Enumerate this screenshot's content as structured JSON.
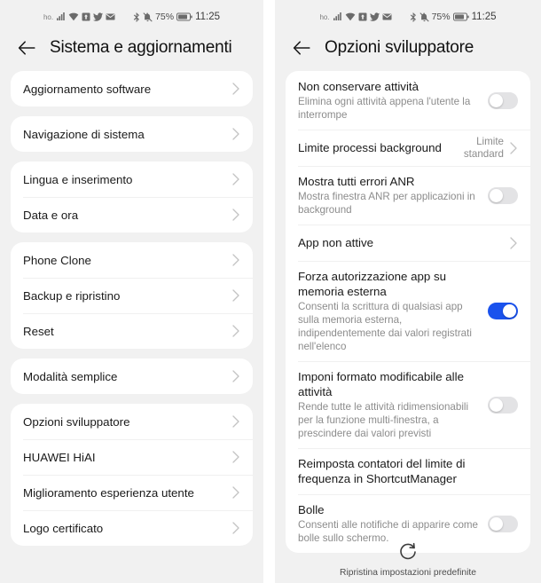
{
  "statusbar": {
    "carrier": "ho.",
    "left_icons": [
      "signal-icon",
      "wifi-icon",
      "vpn-key-icon",
      "twitter-icon",
      "mail-icon"
    ],
    "right_icons": [
      "bluetooth-icon",
      "mute-bell-icon"
    ],
    "battery_percent": "75%",
    "battery_icon": "battery-icon",
    "clock": "11:25"
  },
  "colors": {
    "page_background": "#f1f1f1",
    "card_background": "#ffffff",
    "toggle_on": "#1a52ed",
    "toggle_off": "#e3e3e5",
    "title_text": "#111111",
    "subtitle_text": "#8c8c8c"
  },
  "left_screen": {
    "title": "Sistema e aggiornamenti",
    "back_icon": "back-arrow-icon",
    "groups": [
      {
        "rows": [
          {
            "title": "Aggiornamento software",
            "chevron": true
          }
        ]
      },
      {
        "rows": [
          {
            "title": "Navigazione di sistema",
            "chevron": true
          }
        ]
      },
      {
        "rows": [
          {
            "title": "Lingua e inserimento",
            "chevron": true
          },
          {
            "title": "Data e ora",
            "chevron": true
          }
        ]
      },
      {
        "rows": [
          {
            "title": "Phone Clone",
            "chevron": true
          },
          {
            "title": "Backup e ripristino",
            "chevron": true
          },
          {
            "title": "Reset",
            "chevron": true
          }
        ]
      },
      {
        "rows": [
          {
            "title": "Modalità semplice",
            "chevron": true
          }
        ]
      },
      {
        "rows": [
          {
            "title": "Opzioni sviluppatore",
            "chevron": true
          },
          {
            "title": "HUAWEI HiAI",
            "chevron": true
          },
          {
            "title": "Miglioramento esperienza utente",
            "chevron": true
          },
          {
            "title": "Logo certificato",
            "chevron": true
          }
        ]
      }
    ]
  },
  "right_screen": {
    "title": "Opzioni sviluppatore",
    "back_icon": "back-arrow-icon",
    "groups": [
      {
        "rows": [
          {
            "title": "Non conservare attività",
            "subtitle": "Elimina ogni attività appena l'utente la interrompe",
            "toggle": "off"
          },
          {
            "title": "Limite processi background",
            "value": "Limite standard",
            "chevron": true
          },
          {
            "title": "Mostra tutti errori ANR",
            "subtitle": "Mostra finestra ANR per applicazioni in background",
            "toggle": "off"
          },
          {
            "title": "App non attive",
            "chevron": true
          },
          {
            "title": "Forza autorizzazione app su memoria esterna",
            "subtitle": "Consenti la scrittura di qualsiasi app sulla memoria esterna, indipendentemente dai valori registrati nell'elenco",
            "toggle": "on"
          },
          {
            "title": "Imponi formato modificabile alle attività",
            "subtitle": "Rende tutte le attività ridimensionabili per la funzione multi-finestra, a prescindere dai valori previsti",
            "toggle": "off"
          },
          {
            "title": "Reimposta contatori del limite di frequenza in ShortcutManager"
          },
          {
            "title": "Bolle",
            "subtitle": "Consenti alle notifiche di apparire come bolle sullo schermo.",
            "toggle": "off"
          }
        ]
      }
    ],
    "restore": {
      "icon": "restore-circular-arrow-icon",
      "label": "Ripristina impostazioni predefinite"
    }
  }
}
